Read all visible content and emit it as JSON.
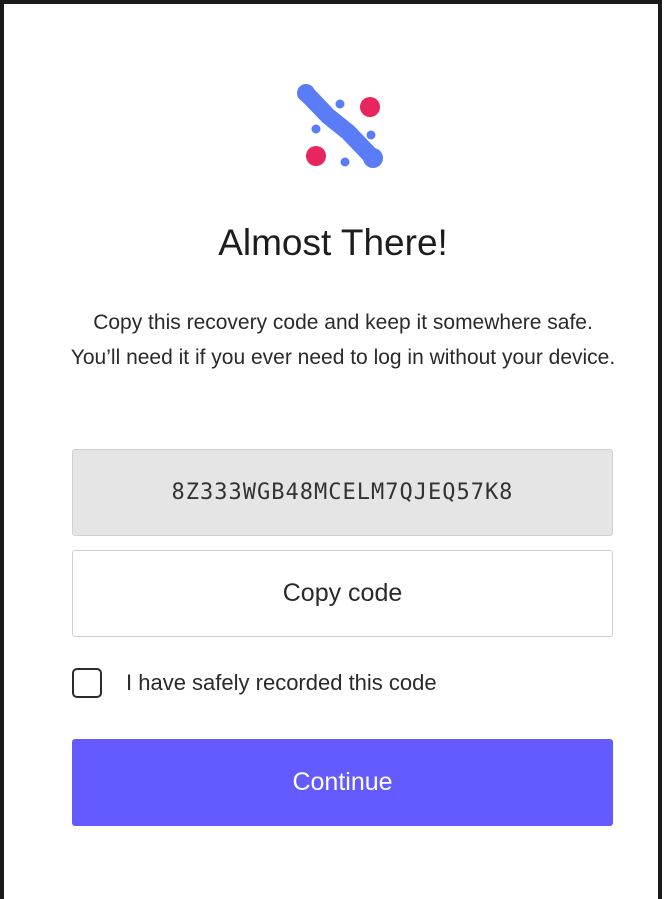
{
  "logo": {
    "icon": "network-nodes-logo",
    "colors": {
      "blue": "#5b7cf7",
      "pink": "#e8255f"
    }
  },
  "header": {
    "title": "Almost There!"
  },
  "instructions": {
    "text": "Copy this recovery code and keep it somewhere safe. You’ll need it if you ever need to log in without your device."
  },
  "recovery": {
    "code": "8Z333WGB48MCELM7QJEQ57K8",
    "copy_label": "Copy code"
  },
  "confirm": {
    "label": "I have safely recorded this code",
    "checked": false
  },
  "actions": {
    "continue_label": "Continue"
  },
  "colors": {
    "accent": "#635bff",
    "code_background": "#e5e5e5"
  }
}
